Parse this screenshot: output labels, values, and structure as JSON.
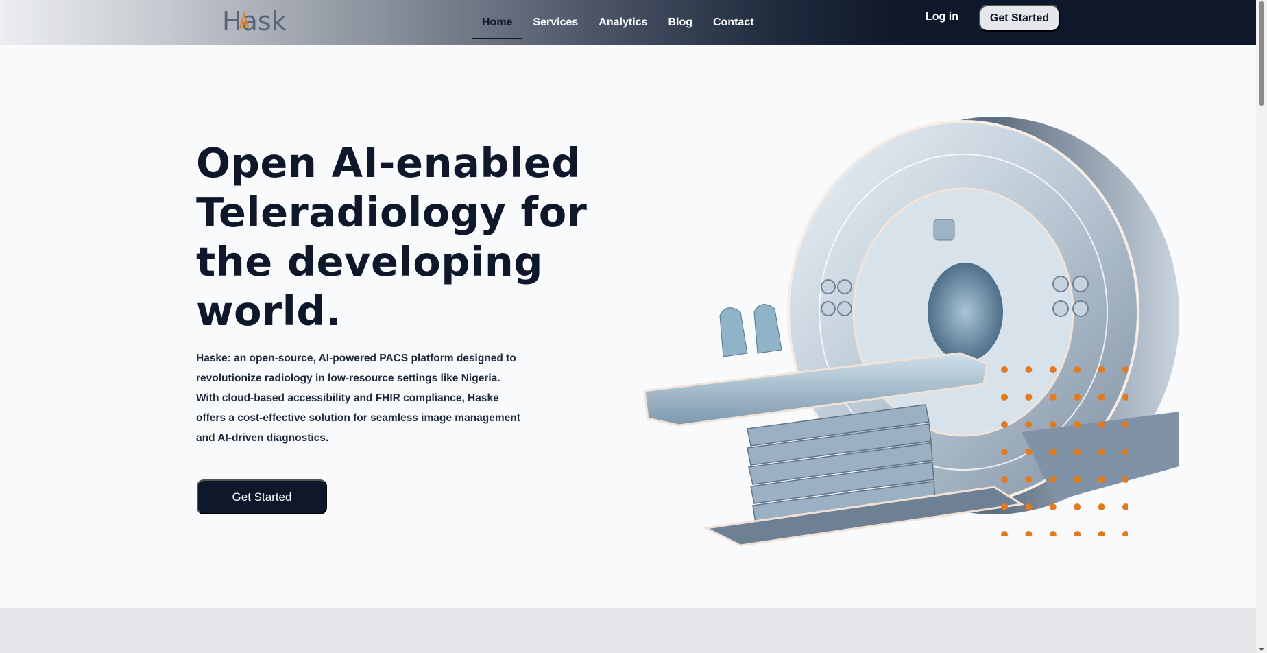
{
  "brand": {
    "logo_text": "Haske"
  },
  "nav": {
    "items": [
      {
        "label": "Home",
        "active": true
      },
      {
        "label": "Services",
        "active": false
      },
      {
        "label": "Analytics",
        "active": false
      },
      {
        "label": "Blog",
        "active": false
      },
      {
        "label": "Contact",
        "active": false
      }
    ],
    "login_label": "Log in",
    "cta_label": "Get Started"
  },
  "hero": {
    "title_lines": [
      "Open AI-enabled",
      "Teleradiology for",
      "the developing",
      "world."
    ],
    "description": "Haske: an open-source, AI-powered PACS platform designed to revolutionize radiology in low-resource settings like Nigeria. With cloud-based accessibility and FHIR compliance, Haske offers a cost-effective solution for seamless image management and AI-driven diagnostics.",
    "cta_label": "Get Started"
  },
  "illustration": {
    "name": "mri-scanner-image"
  },
  "colors": {
    "primary": "#0f172a",
    "accent_dots": "#e07b22",
    "background": "#f8fafc",
    "section_gray": "#e5e7eb"
  }
}
